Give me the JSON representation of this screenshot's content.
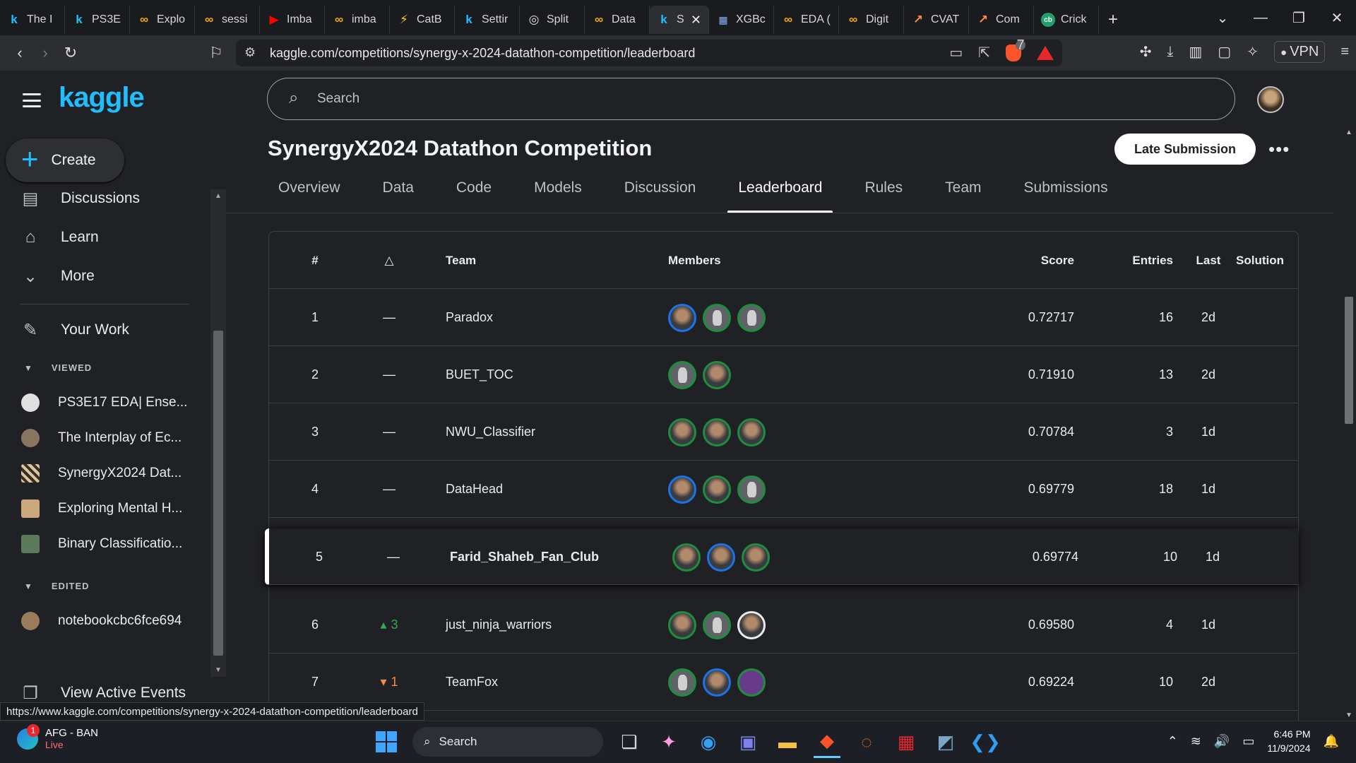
{
  "browser": {
    "tabs": [
      {
        "label": "The I",
        "icon": "k"
      },
      {
        "label": "PS3E",
        "icon": "k"
      },
      {
        "label": "Explo",
        "icon": "∞"
      },
      {
        "label": "sessi",
        "icon": "∞"
      },
      {
        "label": "Imba",
        "icon": "▶"
      },
      {
        "label": "imba",
        "icon": "∞"
      },
      {
        "label": "CatB",
        "icon": "⚡"
      },
      {
        "label": "Settir",
        "icon": "k"
      },
      {
        "label": "Split",
        "icon": "◎"
      },
      {
        "label": "Data",
        "icon": "∞"
      },
      {
        "label": "S",
        "icon": "k"
      },
      {
        "label": "XGBc",
        "icon": "▦"
      },
      {
        "label": "EDA (",
        "icon": "∞"
      },
      {
        "label": "Digit",
        "icon": "∞"
      },
      {
        "label": "CVAT",
        "icon": "↗"
      },
      {
        "label": "Com",
        "icon": "↗"
      },
      {
        "label": "Crick",
        "icon": "cb"
      }
    ],
    "url": "kaggle.com/competitions/synergy-x-2024-datathon-competition/leaderboard",
    "status_url": "https://www.kaggle.com/competitions/synergy-x-2024-datathon-competition/leaderboard",
    "brave_badge": "7",
    "vpn_label": "VPN"
  },
  "sidebar": {
    "logo": "kaggle",
    "create_label": "Create",
    "items": [
      {
        "label": "Discussions",
        "icon": "▤"
      },
      {
        "label": "Learn",
        "icon": "🎓"
      },
      {
        "label": "More",
        "icon": "⌄"
      },
      {
        "label": "Your Work",
        "icon": "✎"
      }
    ],
    "viewed_header": "VIEWED",
    "viewed": [
      "PS3E17 EDA| Ense...",
      "The Interplay of Ec...",
      "SynergyX2024 Dat...",
      "Exploring Mental H...",
      "Binary Classificatio..."
    ],
    "edited_header": "EDITED",
    "edited": [
      "notebookcbc6fce694"
    ],
    "active_events": "View Active Events"
  },
  "header": {
    "search_placeholder": "Search",
    "competition_title": "SynergyX2024 Datathon Competition",
    "late_submission": "Late Submission",
    "tabs": [
      "Overview",
      "Data",
      "Code",
      "Models",
      "Discussion",
      "Leaderboard",
      "Rules",
      "Team",
      "Submissions"
    ],
    "selected_tab": "Leaderboard"
  },
  "leaderboard": {
    "columns": {
      "rank": "#",
      "delta": "△",
      "team": "Team",
      "members": "Members",
      "score": "Score",
      "entries": "Entries",
      "last": "Last",
      "solution": "Solution"
    },
    "rows": [
      {
        "rank": "1",
        "delta": "—",
        "team": "Paradox",
        "score": "0.72717",
        "entries": "16",
        "last": "2d"
      },
      {
        "rank": "2",
        "delta": "—",
        "team": "BUET_TOC",
        "score": "0.71910",
        "entries": "13",
        "last": "2d"
      },
      {
        "rank": "3",
        "delta": "—",
        "team": "NWU_Classifier",
        "score": "0.70784",
        "entries": "3",
        "last": "1d"
      },
      {
        "rank": "4",
        "delta": "—",
        "team": "DataHead",
        "score": "0.69779",
        "entries": "18",
        "last": "1d"
      },
      {
        "rank": "5",
        "delta": "—",
        "team": "Farid_Shaheb_Fan_Club",
        "score": "0.69774",
        "entries": "10",
        "last": "1d"
      },
      {
        "rank": "6",
        "delta_arrow": "▴",
        "delta": "3",
        "team": "just_ninja_warriors",
        "score": "0.69580",
        "entries": "4",
        "last": "1d"
      },
      {
        "rank": "7",
        "delta_arrow": "▾",
        "delta": "1",
        "team": "TeamFox",
        "score": "0.69224",
        "entries": "10",
        "last": "2d"
      }
    ]
  },
  "taskbar": {
    "weather_title": "AFG - BAN",
    "weather_sub": "Live",
    "weather_badge": "1",
    "search_label": "Search",
    "time": "6:46 PM",
    "date": "11/9/2024"
  }
}
